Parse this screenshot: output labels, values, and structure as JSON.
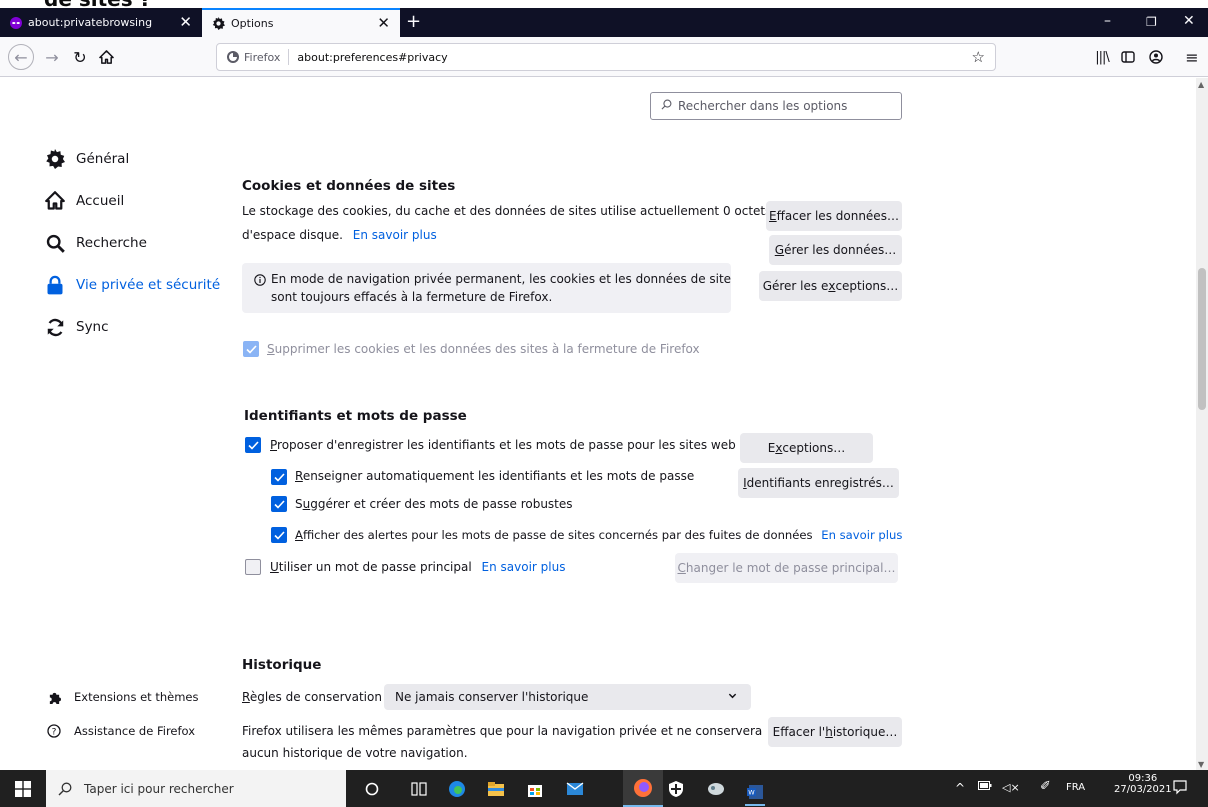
{
  "crop_text": "de sites ?",
  "tabs": [
    {
      "label": "about:privatebrowsing",
      "close": "✕"
    },
    {
      "label": "Options",
      "close": "✕"
    }
  ],
  "new_tab": "+",
  "window": {
    "min": "–",
    "max": "❐",
    "close": "✕"
  },
  "urlbar": {
    "identity": "Firefox",
    "url": "about:preferences#privacy"
  },
  "search_options": {
    "placeholder": "Rechercher dans les options"
  },
  "categories": [
    {
      "label": "Général"
    },
    {
      "label": "Accueil"
    },
    {
      "label": "Recherche"
    },
    {
      "label": "Vie privée et sécurité"
    },
    {
      "label": "Sync"
    }
  ],
  "bottom_links": [
    {
      "label": "Extensions et thèmes"
    },
    {
      "label": "Assistance de Firefox"
    }
  ],
  "cookies": {
    "title": "Cookies et données de sites",
    "desc1": "Le stockage des cookies, du cache et des données de sites utilise actuellement 0 octets",
    "desc2": "d'espace disque.",
    "learn_more": "En savoir plus",
    "clear_btn": {
      "pre": "",
      "u": "E",
      "post": "ffacer les données…"
    },
    "manage_btn": {
      "pre": "",
      "u": "G",
      "post": "érer les données…"
    },
    "exceptions_btn": {
      "pre": "Gérer les e",
      "u": "x",
      "post": "ceptions…"
    },
    "info_line1": "En mode de navigation privée permanent, les cookies et les données de site",
    "info_line2": "sont toujours effacés à la fermeture de Firefox.",
    "delete_on_close": {
      "pre": "",
      "u": "S",
      "post": "upprimer les cookies et les données des sites à la fermeture de Firefox",
      "checked": true,
      "disabled": true
    }
  },
  "logins": {
    "title": "Identifiants et mots de passe",
    "ask_save": {
      "pre": "",
      "u": "P",
      "post": "roposer d'enregistrer les identifiants et les mots de passe pour les sites web",
      "checked": true
    },
    "exceptions_btn": {
      "pre": "E",
      "u": "x",
      "post": "ceptions…"
    },
    "autofill": {
      "pre": "",
      "u": "R",
      "post": "enseigner automatiquement les identifiants et les mots de passe",
      "checked": true
    },
    "saved_btn": {
      "pre": "",
      "u": "I",
      "post": "dentifiants enregistrés…"
    },
    "suggest": {
      "pre": "S",
      "u": "u",
      "post": "ggérer et créer des mots de passe robustes",
      "checked": true
    },
    "breach": {
      "pre": "",
      "u": "A",
      "post": "fficher des alertes pour les mots de passe de sites concernés par des fuites de données",
      "checked": true
    },
    "breach_learn": "En savoir plus",
    "primary": {
      "pre": "",
      "u": "U",
      "post": "tiliser un mot de passe principal",
      "checked": false
    },
    "primary_learn": "En savoir plus",
    "change_primary_btn": {
      "pre": "",
      "u": "C",
      "post": "hanger le mot de passe principal…"
    }
  },
  "history": {
    "title": "Historique",
    "rule_label": {
      "pre": "",
      "u": "R",
      "post": "ègles de conservation"
    },
    "rule_value": "Ne jamais conserver l'historique",
    "desc1": "Firefox utilisera les mêmes paramètres que pour la navigation privée et ne conservera",
    "desc2": "aucun historique de votre navigation.",
    "clear_btn": {
      "pre": "Effacer l'",
      "u": "h",
      "post": "istorique…"
    }
  },
  "taskbar": {
    "search_placeholder": "Taper ici pour rechercher",
    "lang": "FRA",
    "time": "09:36",
    "date": "27/03/2021"
  },
  "colors": {
    "accent": "#0060df",
    "tab_bar": "#0f1126",
    "taskbar": "#202020"
  }
}
